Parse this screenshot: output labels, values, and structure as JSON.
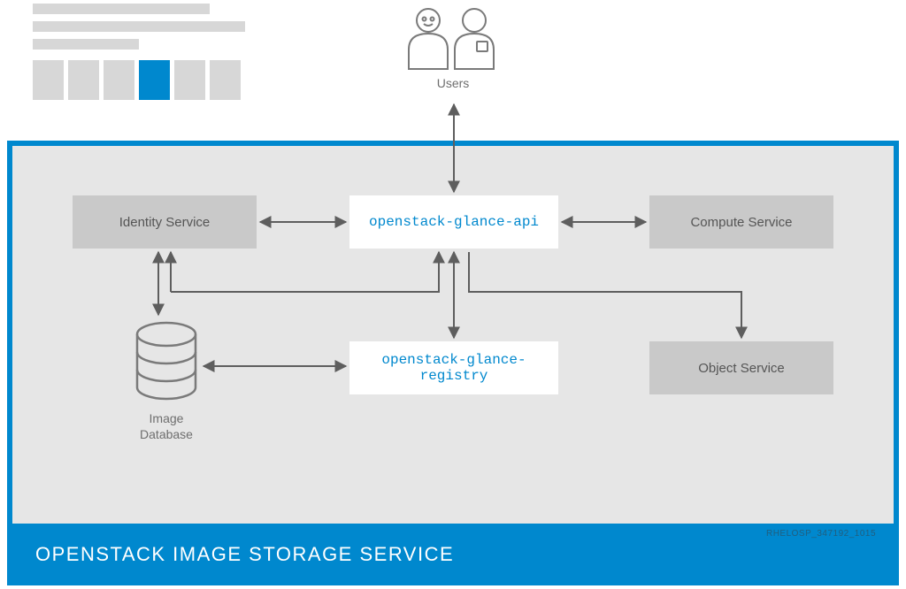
{
  "nodes": {
    "users": "Users",
    "identity_service": "Identity Service",
    "glance_api": "openstack-glance-api",
    "compute_service": "Compute Service",
    "glance_registry": "openstack-glance-registry",
    "object_service": "Object Service",
    "image_database": "Image\nDatabase"
  },
  "footer": {
    "title": "OPENSTACK IMAGE STORAGE SERVICE",
    "tag": "RHELOSP_347192_1015"
  },
  "colors": {
    "accent": "#0088ce",
    "panel_bg": "#e6e6e6",
    "box_gray": "#c9c9c9",
    "arrow": "#5e5e5e"
  }
}
